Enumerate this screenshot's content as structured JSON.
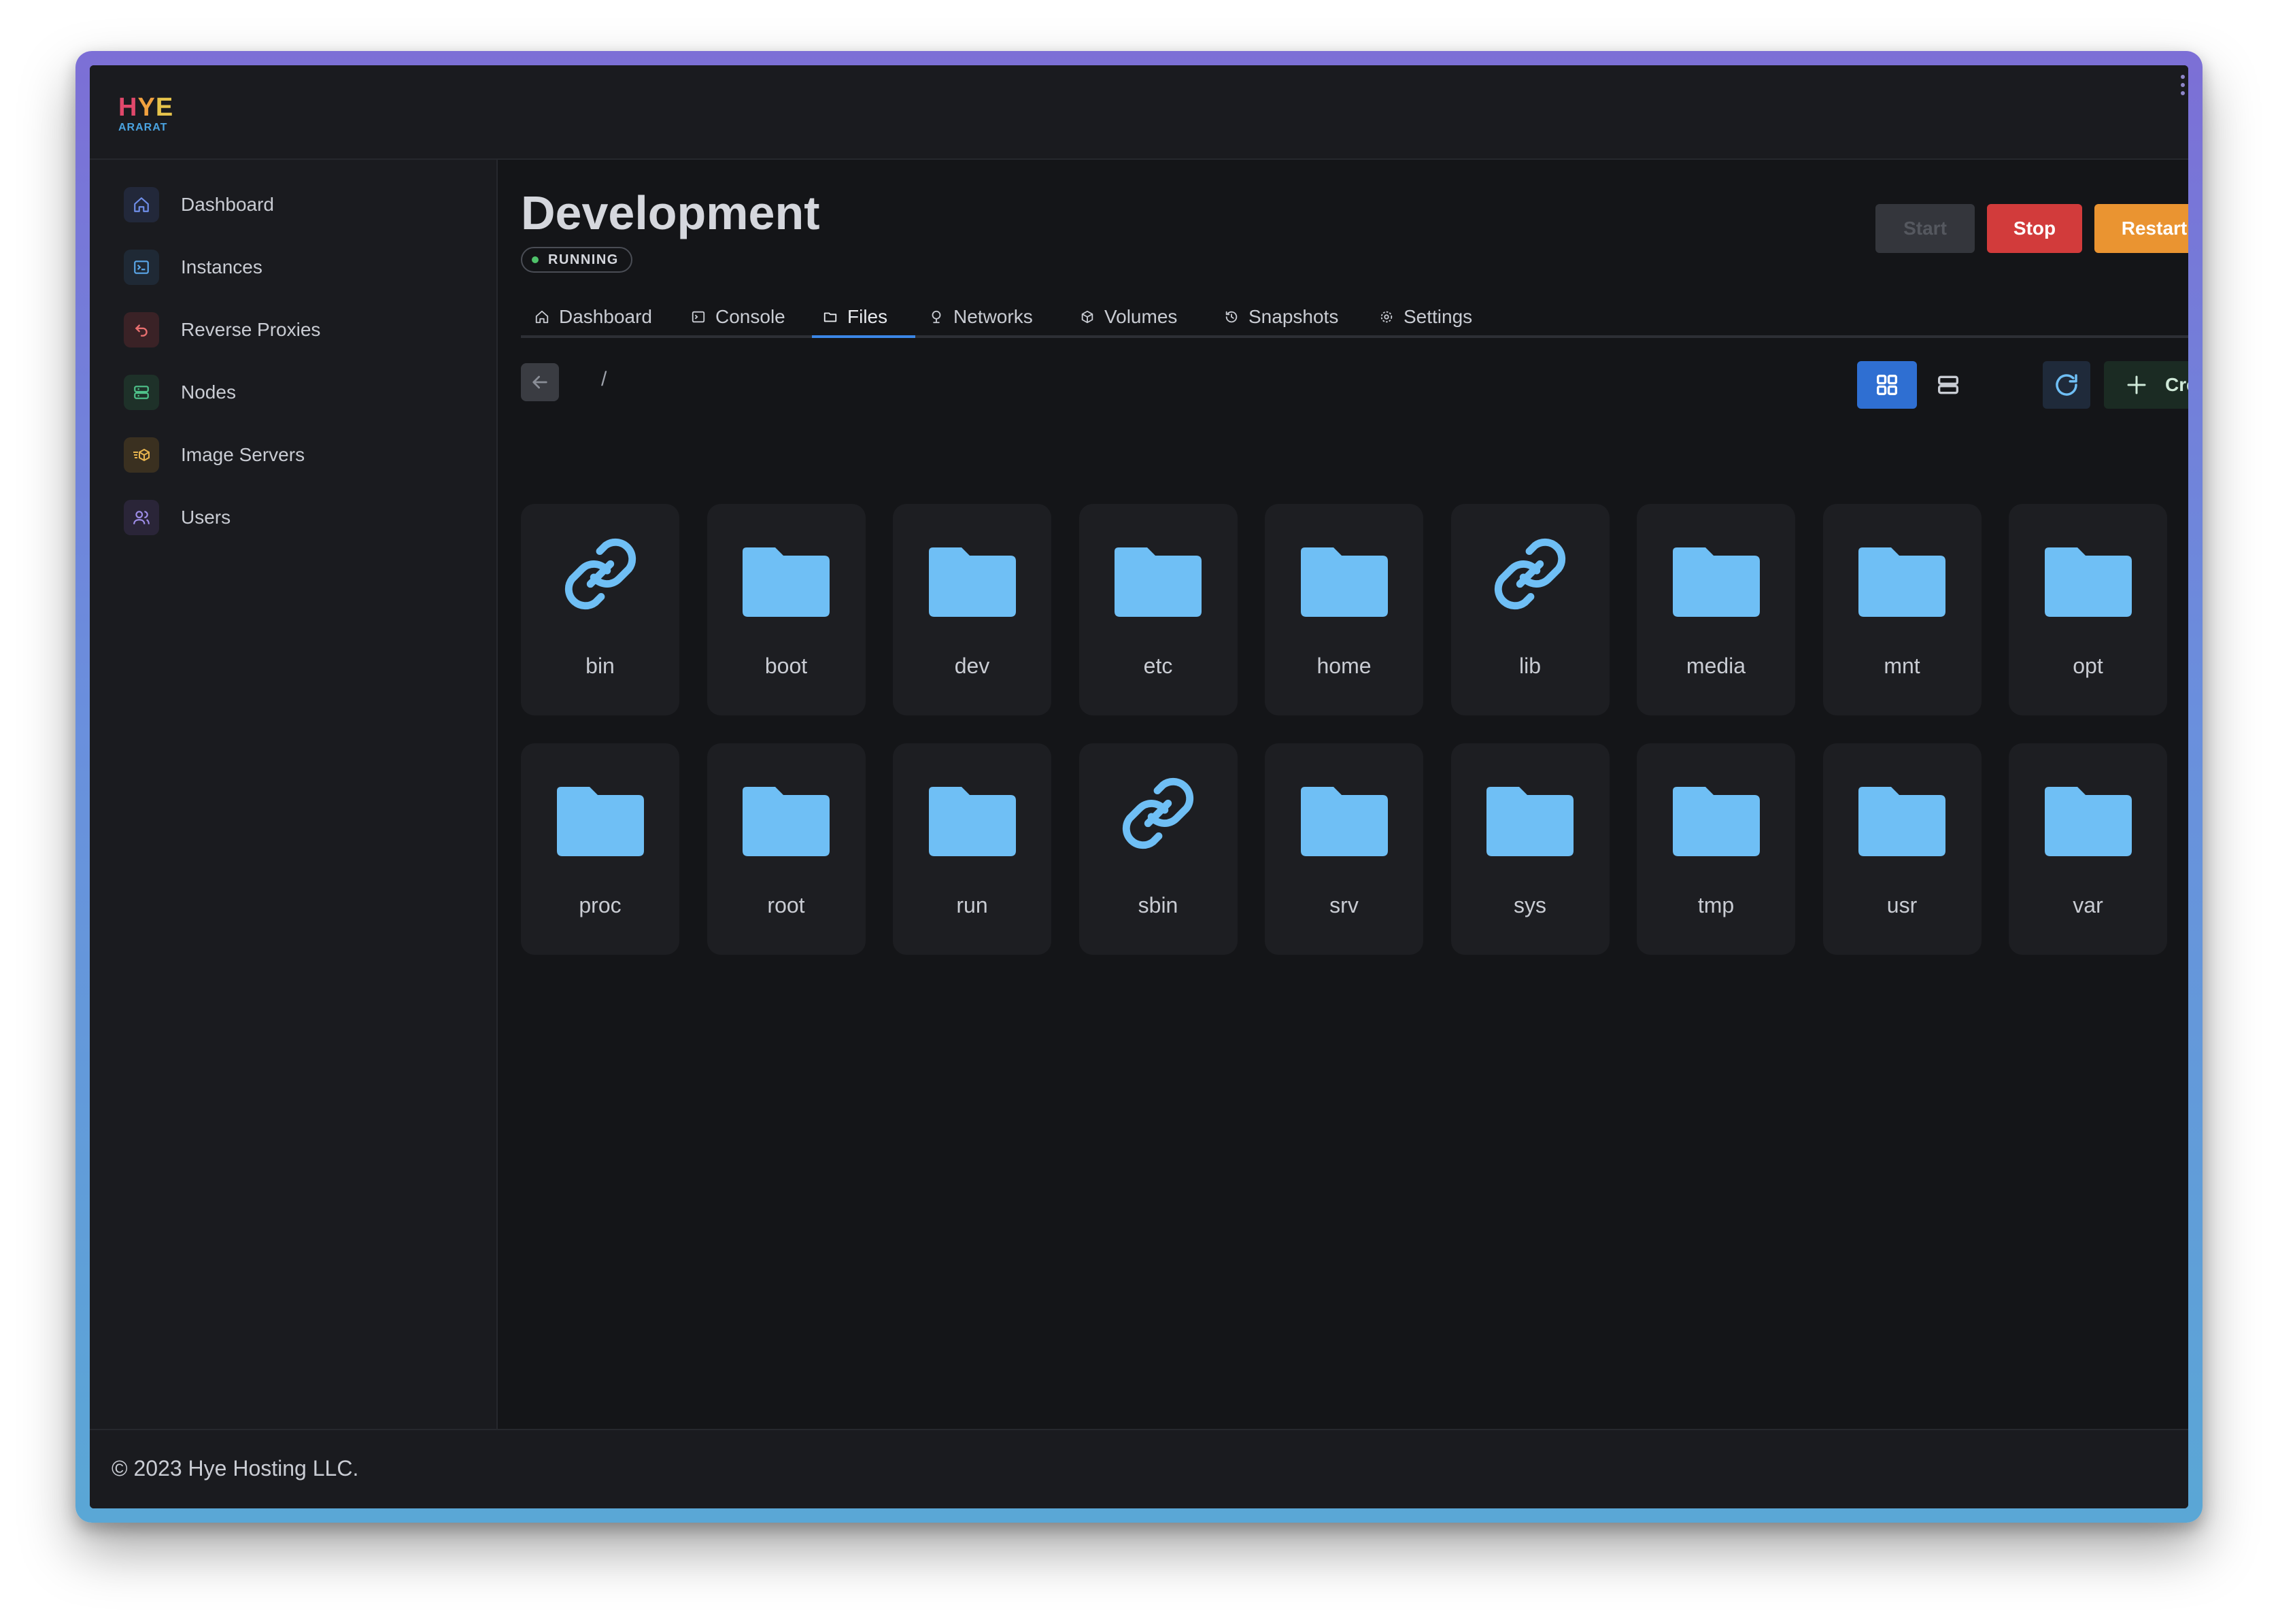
{
  "app": {
    "logo_top": [
      "H",
      "Y",
      "E"
    ],
    "logo_sub": "ARARAT"
  },
  "sidebar": {
    "items": [
      {
        "label": "Dashboard",
        "icon": "home-icon",
        "color": "#6f8ee8",
        "bg": "#22283a"
      },
      {
        "label": "Instances",
        "icon": "terminal-icon",
        "color": "#5aa6e8",
        "bg": "#1f2935"
      },
      {
        "label": "Reverse Proxies",
        "icon": "redirect-icon",
        "color": "#e86f6f",
        "bg": "#3a2226"
      },
      {
        "label": "Nodes",
        "icon": "server-icon",
        "color": "#4fc28a",
        "bg": "#1e3129"
      },
      {
        "label": "Image Servers",
        "icon": "shipping-box-icon",
        "color": "#e8b54f",
        "bg": "#3a3020"
      },
      {
        "label": "Users",
        "icon": "users-icon",
        "color": "#9f8ee8",
        "bg": "#2a2538"
      }
    ]
  },
  "header": {
    "title": "Development",
    "status": "RUNNING",
    "status_color": "#4fc26a",
    "buttons": {
      "start": "Start",
      "stop": "Stop",
      "restart": "Restart"
    }
  },
  "tabs": [
    {
      "label": "Dashboard",
      "icon": "home-icon"
    },
    {
      "label": "Console",
      "icon": "terminal-icon"
    },
    {
      "label": "Files",
      "icon": "folder-icon",
      "active": true
    },
    {
      "label": "Networks",
      "icon": "network-icon"
    },
    {
      "label": "Volumes",
      "icon": "cube-icon"
    },
    {
      "label": "Snapshots",
      "icon": "history-icon"
    },
    {
      "label": "Settings",
      "icon": "gear-icon"
    }
  ],
  "toolbar": {
    "path": "/",
    "create_label": "Create"
  },
  "files": [
    {
      "name": "bin",
      "type": "link"
    },
    {
      "name": "boot",
      "type": "folder"
    },
    {
      "name": "dev",
      "type": "folder"
    },
    {
      "name": "etc",
      "type": "folder"
    },
    {
      "name": "home",
      "type": "folder"
    },
    {
      "name": "lib",
      "type": "link"
    },
    {
      "name": "media",
      "type": "folder"
    },
    {
      "name": "mnt",
      "type": "folder"
    },
    {
      "name": "opt",
      "type": "folder"
    },
    {
      "name": "proc",
      "type": "folder"
    },
    {
      "name": "root",
      "type": "folder"
    },
    {
      "name": "run",
      "type": "folder"
    },
    {
      "name": "sbin",
      "type": "link"
    },
    {
      "name": "srv",
      "type": "folder"
    },
    {
      "name": "sys",
      "type": "folder"
    },
    {
      "name": "tmp",
      "type": "folder"
    },
    {
      "name": "usr",
      "type": "folder"
    },
    {
      "name": "var",
      "type": "folder"
    }
  ],
  "footer": {
    "copyright": "© 2023 Hye Hosting LLC."
  },
  "colors": {
    "accent": "#3b86e6",
    "file_icon": "#6fbff5",
    "stop": "#d23b3b",
    "restart": "#ea9431"
  }
}
